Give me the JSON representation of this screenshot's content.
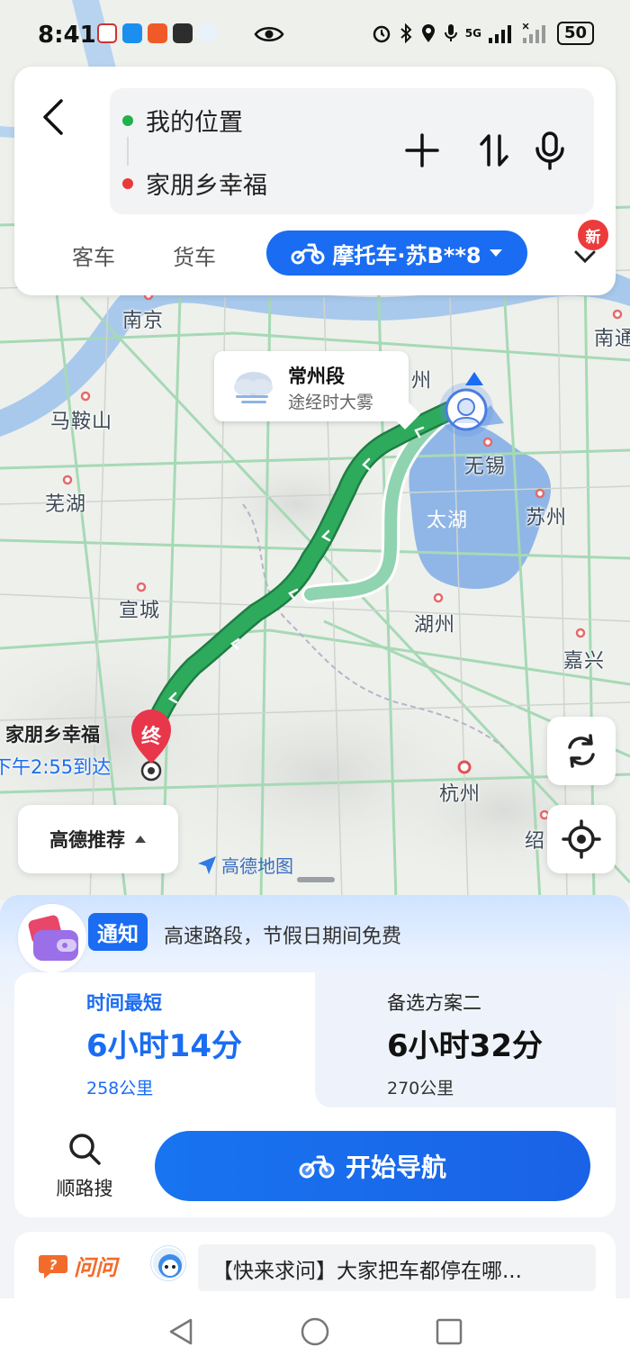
{
  "status_bar": {
    "time": "8:41",
    "network": "5G",
    "battery": "50"
  },
  "search": {
    "origin": "我的位置",
    "destination": "家朋乡幸福",
    "origin_color": "#22b14c",
    "destination_color": "#e83a3a"
  },
  "vehicle_tabs": {
    "car": "客车",
    "truck": "货车",
    "motorcycle": "摩托车·苏B**8",
    "new_badge": "新"
  },
  "map": {
    "cities": {
      "nanjing": "南京",
      "maanshan": "马鞍山",
      "wuhu": "芜湖",
      "xuancheng": "宣城",
      "huzhou": "湖州",
      "hangzhou": "杭州",
      "jiaxing": "嘉兴",
      "suzhou": "苏州",
      "wuxi": "无锡",
      "changzhou_fragment": "州",
      "nantong_fragment": "南通",
      "shaoxing_fragment": "绍"
    },
    "lake": "太湖",
    "weather_alert": {
      "title": "常州段",
      "detail": "途经时大雾"
    },
    "destination_marker": "终",
    "destination_name": "家朋乡幸福",
    "eta": "下午2:55到达",
    "recommend_label": "高德推荐",
    "brand": "高德地图",
    "route_color": "#2eaa5c"
  },
  "notice": {
    "tag": "通知",
    "text": "高速路段，节假日期间免费"
  },
  "plans": [
    {
      "label": "时间最短",
      "duration": "6小时14分",
      "distance": "258公里",
      "selected": true
    },
    {
      "label": "备选方案二",
      "duration": "6小时32分",
      "distance": "270公里",
      "selected": false
    }
  ],
  "actions": {
    "along_search": "顺路搜",
    "start_navigation": "开始导航"
  },
  "ask": {
    "brand": "问问",
    "text": "【快来求问】大家把车都停在哪..."
  },
  "colors": {
    "accent": "#1a6cf2",
    "route_main": "#2eaa5c",
    "route_alt": "#8fd3b0"
  }
}
